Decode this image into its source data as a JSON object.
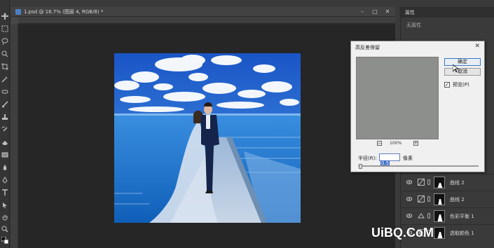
{
  "document": {
    "title": "1.psd @ 16.7% (图层 4, RGB/8) *",
    "window_controls": [
      "–",
      "□",
      "✕"
    ]
  },
  "properties_panel": {
    "tab_label": "属性",
    "subtitle": "无属性"
  },
  "dialog": {
    "title": "高反差保留",
    "close_label": "✕",
    "ok_label": "确定",
    "cancel_label": "取消",
    "preview_label": "预览(P)",
    "preview_checked": true,
    "zoom_percent": "100%",
    "zoom_out_label": "−",
    "zoom_in_label": "+",
    "radius_label": "半径(R):",
    "radius_value": "0.5",
    "radius_unit": "像素"
  },
  "layers": [
    {
      "name": "曲线 2",
      "icon": "curves-icon"
    },
    {
      "name": "曲线 2",
      "icon": "curves-icon"
    },
    {
      "name": "色彩平衡 1",
      "icon": "color-balance-icon"
    },
    {
      "name": "选取颜色 1",
      "icon": "selective-color-icon"
    }
  ],
  "watermark": "UiBQ.CoM",
  "colors": {
    "app_bg": "#3a3a3a",
    "canvas_bg": "#262626",
    "dialog_bg": "#f0f0f0",
    "accent": "#3d6fc4",
    "sky": "#1f63c9",
    "sea": "#1c73cc"
  }
}
